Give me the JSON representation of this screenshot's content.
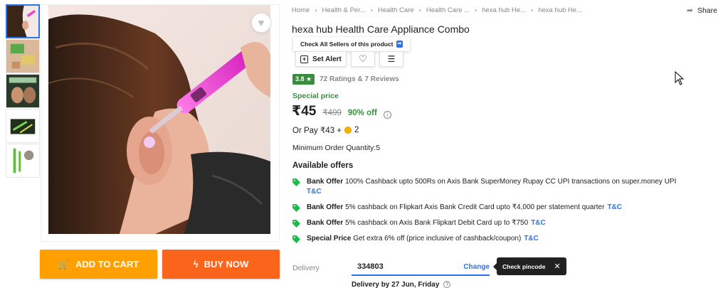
{
  "breadcrumb": [
    "Home",
    "Health & Per...",
    "Health Care",
    "Health Care ...",
    "hexa hub He...",
    "hexa hub He..."
  ],
  "share_label": "Share",
  "product": {
    "title": "hexa hub Health Care Appliance Combo",
    "sellers_tooltip": "Check All Sellers of this product",
    "set_alert_label": "Set Alert",
    "rating": "3.8",
    "ratings_reviews": "72 Ratings & 7 Reviews",
    "special_price_label": "Special price",
    "price": "₹45",
    "mrp": "₹499",
    "discount": "90% off",
    "or_pay": "Or Pay ₹43 +",
    "coins": "2",
    "min_order": "Minimum Order Quantity:5"
  },
  "offers_title": "Available offers",
  "offers": [
    {
      "kind": "Bank Offer",
      "text": "100% Cashback upto 500Rs on Axis Bank SuperMoney Rupay CC UPI transactions on super.money UPI",
      "tc": "T&C"
    },
    {
      "kind": "Bank Offer",
      "text": "5% cashback on Flipkart Axis Bank Credit Card upto ₹4,000 per statement quarter",
      "tc": "T&C"
    },
    {
      "kind": "Bank Offer",
      "text": "5% cashback on Axis Bank Flipkart Debit Card up to ₹750",
      "tc": "T&C"
    },
    {
      "kind": "Special Price",
      "text": "Get extra 6% off (price inclusive of cashback/coupon)",
      "tc": "T&C"
    }
  ],
  "delivery": {
    "label": "Delivery",
    "pincode": "334803",
    "change_label": "Change",
    "check_tooltip": "Check pincode",
    "delivery_date": "Delivery by 27 Jun, Friday"
  },
  "buttons": {
    "add_to_cart": "ADD TO CART",
    "buy_now": "BUY NOW"
  },
  "colors": {
    "add_to_cart": "#ff9f00",
    "buy_now": "#fb641b",
    "rating_badge": "#388e3c",
    "link_blue": "#2874f0"
  }
}
